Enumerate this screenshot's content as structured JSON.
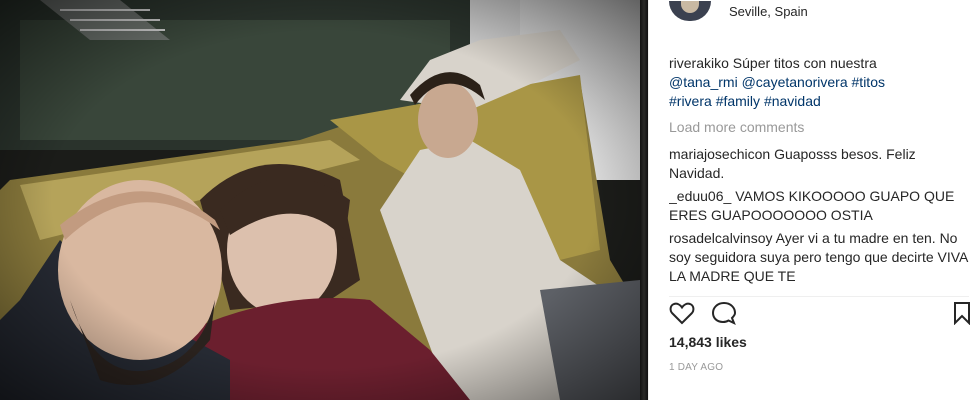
{
  "header": {
    "location": "Seville, Spain"
  },
  "caption": {
    "username": "riverakiko",
    "text": "Súper titos con nuestra",
    "tags": [
      "@tana_rmi",
      "@cayetanorivera",
      "#titos",
      "#rivera",
      "#family",
      "#navidad"
    ]
  },
  "load_more": "Load more comments",
  "comments": [
    {
      "username": "mariajosechicon",
      "text": "Guaposss besos. Feliz Navidad."
    },
    {
      "username": "_eduu06_",
      "text": "VAMOS KIKOOOOO GUAPO QUE ERES GUAPOOOOOOO OSTIA"
    },
    {
      "username": "rosadelcalvinsoy",
      "text": "Ayer vi a tu madre en ten. No soy seguidora suya pero tengo que decirte VIVA LA MADRE QUE TE"
    }
  ],
  "stats": {
    "likes": "14,843 likes",
    "date": "1 DAY AGO"
  },
  "icons": [
    "heart-icon",
    "comment-icon",
    "bookmark-icon"
  ],
  "colors": {
    "link": "#003569",
    "muted": "#999999",
    "text": "#262626"
  }
}
